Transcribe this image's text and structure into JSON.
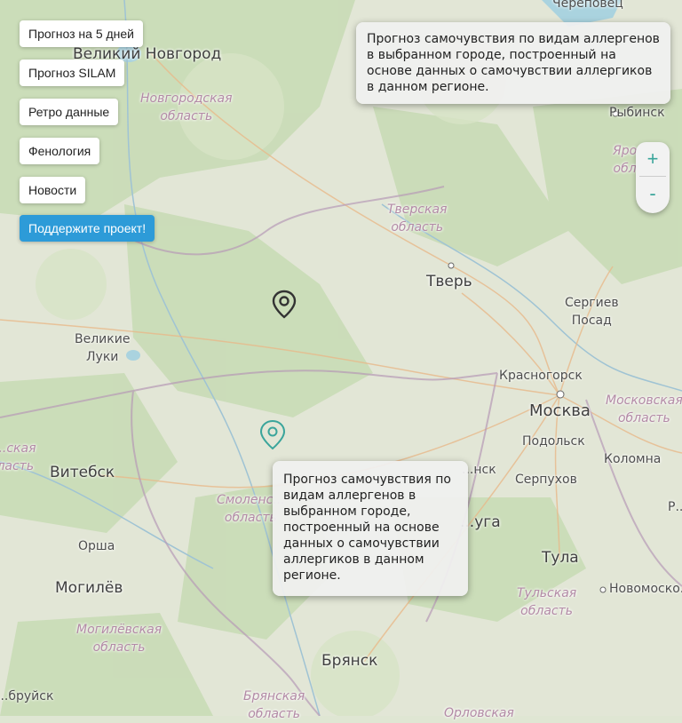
{
  "buttons": {
    "forecast5": "Прогноз на 5 дней",
    "silam": "Прогноз SILAM",
    "retro": "Ретро данные",
    "phenology": "Фенология",
    "news": "Новости",
    "support": "Поддержите проект!"
  },
  "zoom": {
    "in": "+",
    "out": "-"
  },
  "tooltips": {
    "top": "Прогноз самочувствия по видам аллергенов в выбранном городе, построенный на основе данных о самочувствии аллергиков в данном регионе.",
    "bottom": "Прогноз самочувствия по видам аллергенов в выбранном городе, построенный на основе данных о самочувствии аллергиков в данном регионе."
  },
  "labels": {
    "cherepovets": "Череповец",
    "vnovgorod": "Великий Новгород",
    "novgorod_region": "Новгородская\nобласть",
    "rybinsk": "Рыбинск",
    "yaroslavl_region": "Яро...\nобл...",
    "tver_region": "Тверская\nобласть",
    "tver": "Тверь",
    "sergiev": "Сергиев\nПосад",
    "vluki": "Великие\nЛуки",
    "krasnogorsk": "Красногорск",
    "moscow": "Москва",
    "moscow_region": "Московская\nобласть",
    "podolsk": "Подольск",
    "kolomna": "Коломна",
    "vitebsk": "Витебск",
    "vitebsk_region": "...ская\nласть",
    "smolensk_region": "Смоленс...\nобласть",
    "obninsk": "...нск",
    "serpukhov": "Серпухов",
    "kaluga": "...уга",
    "orsha": "Орша",
    "tula": "Тула",
    "mogilev": "Могилёв",
    "novomoskovsk": "Новомоско...",
    "tula_region": "Тульская\nобласть",
    "mogilev_region": "Могилёвская\nобласть",
    "bryansk": "Брянск",
    "bryansk_region": "Брянская\nобласть",
    "oryol_region": "Орловская",
    "bobruysk": "...бруйск",
    "r_edge": "Р..."
  },
  "colors": {
    "accent": "#2d9bd8",
    "pin_active": "#3aa59b",
    "pin": "#333333"
  }
}
